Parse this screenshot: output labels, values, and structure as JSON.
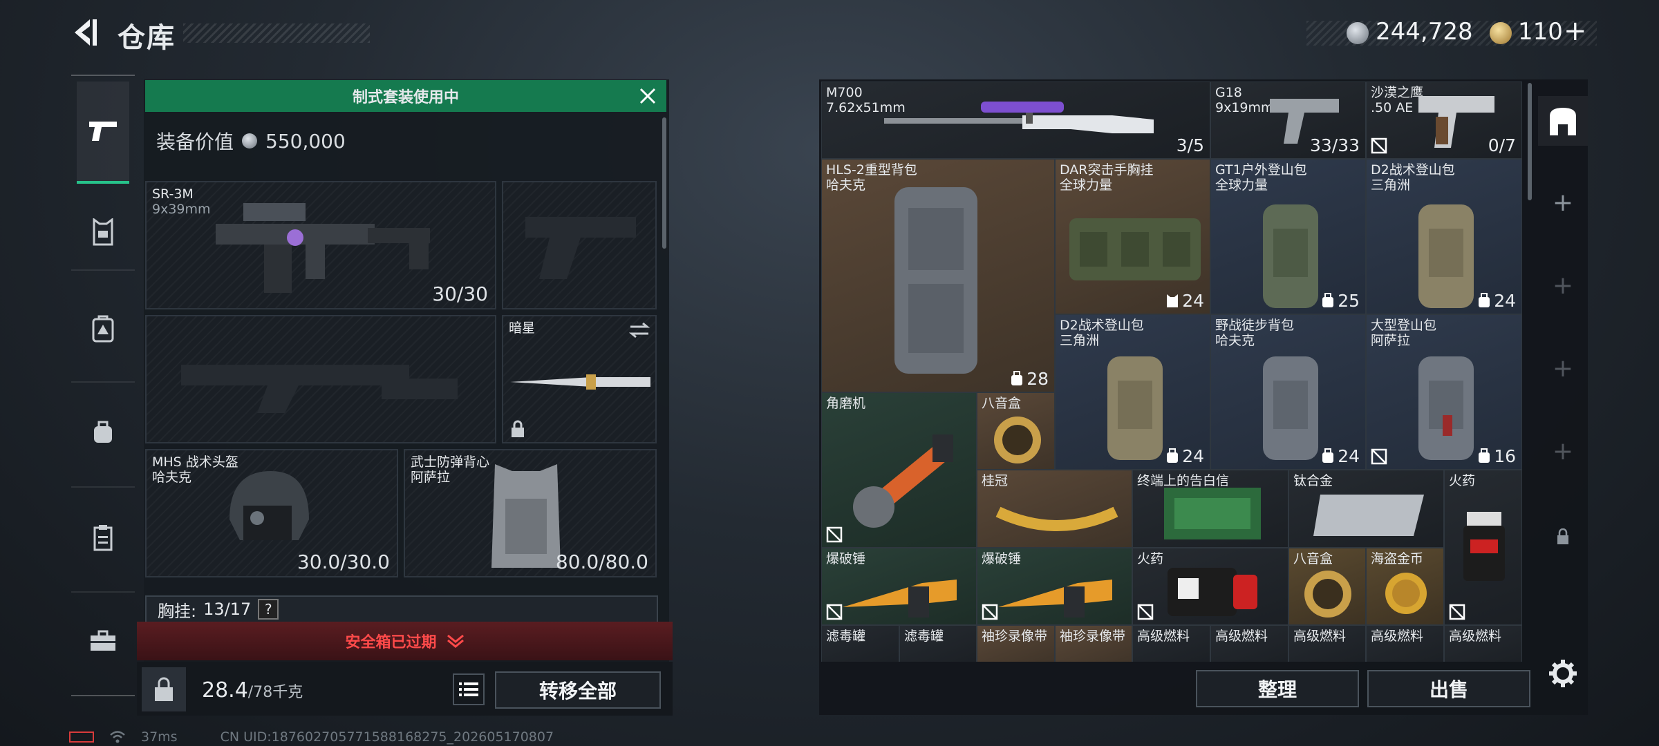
{
  "header": {
    "title": "仓库",
    "silver_amount": "244,728",
    "gold_amount": "110",
    "add_symbol": "+"
  },
  "loadout": {
    "banner": "制式套装使用中",
    "value_label": "装备价值",
    "value_amount": "550,000",
    "primary": {
      "name": "SR-3M",
      "ammo": "9x39mm",
      "count": "30/30"
    },
    "melee": {
      "name": "暗星"
    },
    "helmet": {
      "name": "MHS 战术头盔",
      "brand": "哈夫克",
      "durability": "30.0/30.0"
    },
    "armor": {
      "name": "武士防弹背心",
      "brand": "阿萨拉",
      "durability": "80.0/80.0"
    },
    "chest_rig": {
      "label": "胸挂:",
      "count": "13/17",
      "help": "?"
    },
    "safe_box": "安全箱已过期",
    "weight_current": "28.4",
    "weight_max": "/78千克",
    "transfer_all": "转移全部"
  },
  "footer": {
    "ping": "37ms",
    "uid": "CN UID:187602705771588168275_202605170807"
  },
  "stash": {
    "items": [
      {
        "name": "M700",
        "sub": "7.62x51mm",
        "count": "3/5"
      },
      {
        "name": "G18",
        "sub": "9x19mm",
        "count": "33/33"
      },
      {
        "name": "沙漠之鹰",
        "sub": ".50 AE",
        "count": "0/7"
      },
      {
        "name": "HLS-2重型背包",
        "sub": "哈夫克",
        "count": "28"
      },
      {
        "name": "DAR突击手胸挂",
        "sub": "全球力量",
        "count": "24"
      },
      {
        "name": "GT1户外登山包",
        "sub": "全球力量",
        "count": "25"
      },
      {
        "name": "D2战术登山包",
        "sub": "三角洲",
        "count": "24"
      },
      {
        "name": "D2战术登山包",
        "sub": "三角洲",
        "count": "24"
      },
      {
        "name": "野战徒步背包",
        "sub": "哈夫克",
        "count": "24"
      },
      {
        "name": "大型登山包",
        "sub": "阿萨拉",
        "count": "16"
      },
      {
        "name": "角磨机",
        "sub": "",
        "count": ""
      },
      {
        "name": "八音盒",
        "sub": "",
        "count": ""
      },
      {
        "name": "桂冠",
        "sub": "",
        "count": ""
      },
      {
        "name": "终端上的告白信",
        "sub": "",
        "count": ""
      },
      {
        "name": "钛合金",
        "sub": "",
        "count": ""
      },
      {
        "name": "火药",
        "sub": "",
        "count": ""
      },
      {
        "name": "爆破锤",
        "sub": "",
        "count": ""
      },
      {
        "name": "爆破锤",
        "sub": "",
        "count": ""
      },
      {
        "name": "火药",
        "sub": "",
        "count": ""
      },
      {
        "name": "八音盒",
        "sub": "",
        "count": ""
      },
      {
        "name": "海盗金币",
        "sub": "",
        "count": ""
      },
      {
        "name": "滤毒罐",
        "sub": "",
        "count": ""
      },
      {
        "name": "滤毒罐",
        "sub": "",
        "count": ""
      },
      {
        "name": "袖珍录像带",
        "sub": "",
        "count": ""
      },
      {
        "name": "袖珍录像带",
        "sub": "",
        "count": ""
      },
      {
        "name": "高级燃料",
        "sub": "",
        "count": ""
      },
      {
        "name": "高级燃料",
        "sub": "",
        "count": ""
      },
      {
        "name": "高级燃料",
        "sub": "",
        "count": ""
      },
      {
        "name": "高级燃料",
        "sub": "",
        "count": ""
      },
      {
        "name": "高级燃料",
        "sub": "",
        "count": ""
      }
    ],
    "sort_button": "整理",
    "sell_button": "出售"
  },
  "colors": {
    "accent_green": "#157a4f",
    "alert_red": "#ff4a4a",
    "cell_brown": "#5a4838",
    "cell_blue": "#2f3a4c"
  }
}
